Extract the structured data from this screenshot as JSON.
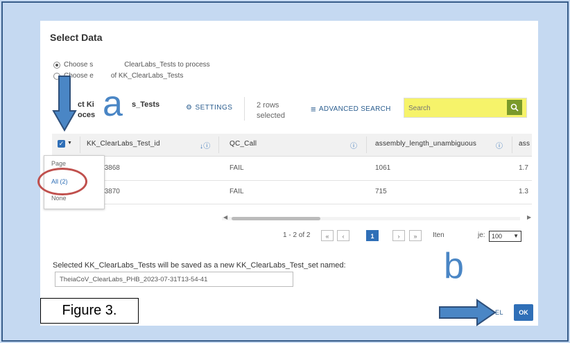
{
  "dialog": {
    "title": "Select Data",
    "radio1": "Choose s",
    "radio1b": "ClearLabs_Tests to process",
    "radio2": "Choose e",
    "radio2b": "of KK_ClearLabs_Tests"
  },
  "toolbar": {
    "table_name_a": "ct Ki",
    "table_name_b": "s_Tests",
    "table_sub": "oces",
    "settings_label": "SETTINGS",
    "rows_selected_line1": "2 rows",
    "rows_selected_line2": "selected",
    "advanced_search_label": "ADVANCED SEARCH",
    "search_placeholder": "Search"
  },
  "table": {
    "columns": [
      "KK_ClearLabs_Test_id",
      "QC_Call",
      "assembly_length_unambiguous",
      "ass"
    ],
    "rows": [
      {
        "id": "-00003868",
        "qc": "FAIL",
        "len": "1061",
        "extra": "1.7"
      },
      {
        "id": "-00003870",
        "qc": "FAIL",
        "len": "715",
        "extra": "1.3"
      }
    ]
  },
  "select_menu": {
    "page": "Page",
    "all": "All (2)",
    "none": "None"
  },
  "pager": {
    "range": "1 - 2 of 2",
    "first": "«",
    "prev": "‹",
    "current": "1",
    "next": "›",
    "last": "»",
    "items_label": "Iten",
    "per_page_label": "je:",
    "per_page_value": "100"
  },
  "footer": {
    "saved_label": "Selected KK_ClearLabs_Tests will be saved as a new KK_ClearLabs_Test_set named:",
    "set_name": "TheiaCoV_ClearLabs_PHB_2023-07-31T13-54-41",
    "cancel_label": "EL",
    "ok_label": "OK"
  },
  "annotations": {
    "label_a": "a",
    "label_b": "b",
    "figure_caption": "Figure 3."
  },
  "colors": {
    "accent": "#2f6fb7",
    "highlight": "#f6f36a",
    "arrow": "#4a86c5",
    "circle": "#c0504d",
    "background": "#c5d9f1"
  }
}
